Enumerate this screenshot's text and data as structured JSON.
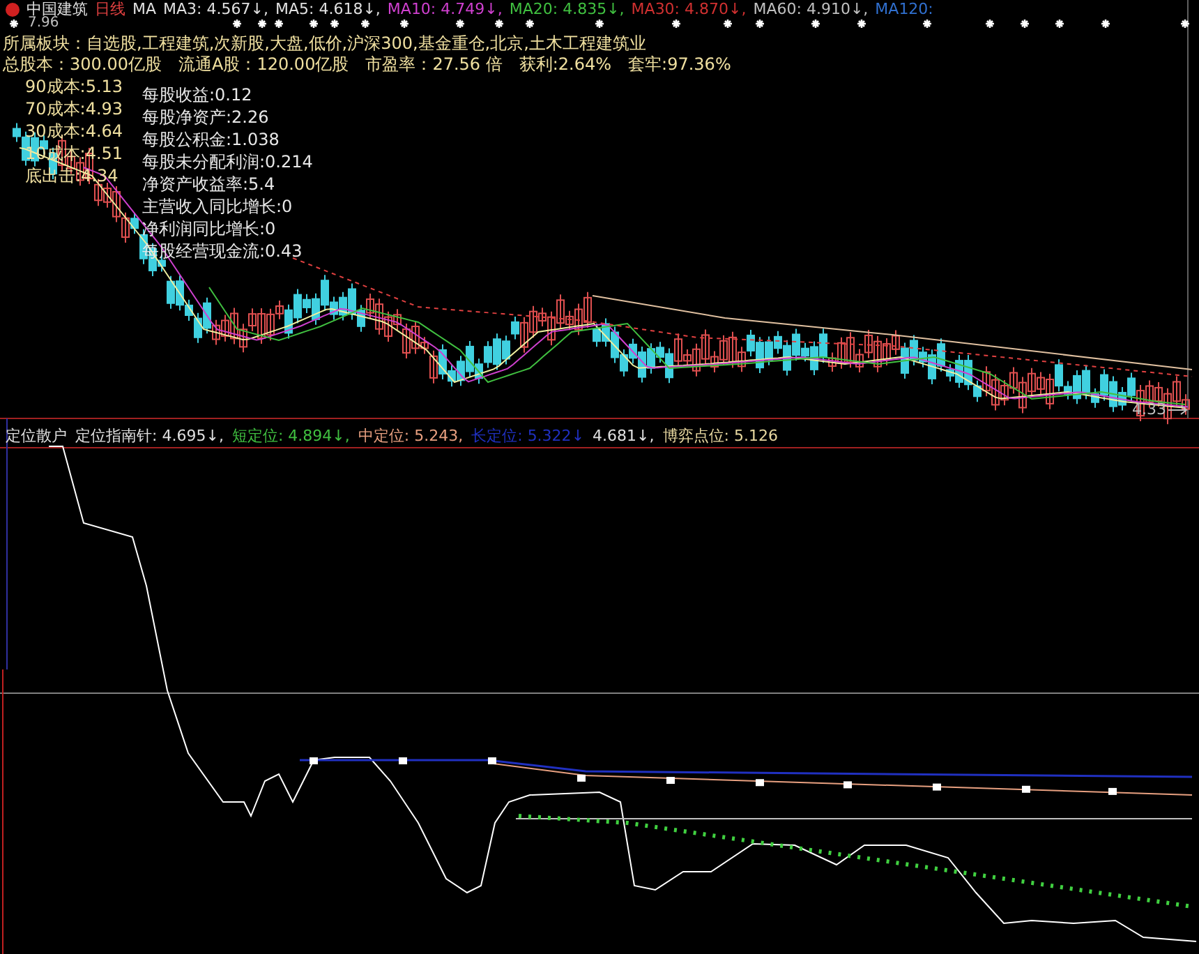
{
  "header": {
    "title": "中国建筑",
    "period": "日线",
    "ma_label": "MA",
    "indicators": [
      {
        "name": "MA3:",
        "value": "4.567",
        "arrow": "↓",
        "sep": ",",
        "color": "#e0e0e0"
      },
      {
        "name": "MA5:",
        "value": "4.618",
        "arrow": "↓",
        "sep": ",",
        "color": "#e0e0e0"
      },
      {
        "name": "MA10:",
        "value": "4.749",
        "arrow": "↓",
        "sep": ",",
        "color": "#d040d0"
      },
      {
        "name": "MA20:",
        "value": "4.835",
        "arrow": "↓",
        "sep": ",",
        "color": "#40c040"
      },
      {
        "name": "MA30:",
        "value": "4.870",
        "arrow": "↓",
        "sep": ",",
        "color": "#d03030"
      },
      {
        "name": "MA60:",
        "value": "4.910",
        "arrow": "↓",
        "sep": ",",
        "color": "#c0c0c0"
      },
      {
        "name": "MA120:",
        "color": "#3070d0"
      }
    ]
  },
  "high_price": "7.96",
  "sectors": "所属板块：自选股,工程建筑,次新股,大盘,低价,沪深300,基金重仓,北京,土木工程建筑业",
  "stats": [
    "总股本：300.00亿股",
    "流通A股：120.00亿股",
    "市盈率：27.56 倍",
    "获利:2.64%",
    "套牢:97.36%"
  ],
  "costs": [
    "90成本:5.13",
    "70成本:4.93",
    "30成本:4.64",
    "10成本:4.51",
    "底出击:4.34"
  ],
  "finance": [
    "每股收益:0.12",
    "每股净资产:2.26",
    "每股公积金:1.038",
    "每股未分配利润:0.214",
    "净资产收益率:5.4",
    "主营收入同比增长:0",
    "净利润同比增长:0",
    "每股经营现金流:0.43"
  ],
  "low_price": "4.33",
  "lower": {
    "title": "定位散户",
    "indicators": [
      {
        "name": "定位指南针:",
        "value": "4.695",
        "arrow": "↓",
        "sep": ",",
        "color": "#e0e0e0"
      },
      {
        "name": "短定位:",
        "value": "4.894",
        "arrow": "↓",
        "sep": ",",
        "color": "#40c040"
      },
      {
        "name": "中定位:",
        "value": "5.243",
        "sep": ",",
        "color": "#e8a080"
      },
      {
        "name": "长定位:",
        "value": "5.322",
        "arrow": "↓",
        "color": "#2030c0"
      },
      {
        "value": "4.681",
        "arrow": "↓",
        "sep": ",",
        "color": "#e0e0e0"
      },
      {
        "name": "博弈点位:",
        "value": "5.126",
        "color": "#e8d8a0"
      }
    ]
  }
}
